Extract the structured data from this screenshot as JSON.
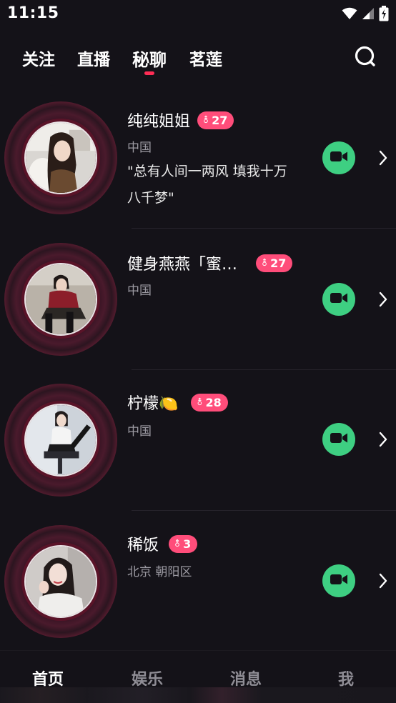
{
  "status_bar": {
    "time": "11:15",
    "icons": [
      "wifi-icon",
      "cell-signal-icon",
      "battery-charging-icon"
    ]
  },
  "top_tabs": [
    {
      "label": "关注"
    },
    {
      "label": "直播"
    },
    {
      "label": "秘聊",
      "active": true
    },
    {
      "label": "茗莲"
    }
  ],
  "search": {
    "icon": "search-icon"
  },
  "users": [
    {
      "name": "纯纯姐姐",
      "gender_symbol": "⚨",
      "age": "27",
      "location": "中国",
      "bio_line1": "\"总有人间一两风  填我十万",
      "bio_line2": "八千梦\""
    },
    {
      "name": "健身燕燕「蜜…",
      "gender_symbol": "⚨",
      "age": "27",
      "location": "中国"
    },
    {
      "name": "柠檬🍋",
      "gender_symbol": "⚨",
      "age": "28",
      "location": "中国"
    },
    {
      "name": "稀饭",
      "gender_symbol": "⚨",
      "age": "3",
      "location": "北京 朝阳区"
    }
  ],
  "bottom_nav": [
    {
      "label": "首页",
      "active": true
    },
    {
      "label": "娱乐"
    },
    {
      "label": "消息"
    },
    {
      "label": "我"
    }
  ],
  "colors": {
    "background": "#141218",
    "accent": "#ff2d55",
    "badge": "#ff4d7a",
    "video_button": "#3ecf82",
    "muted_text": "#9c9aa2"
  }
}
